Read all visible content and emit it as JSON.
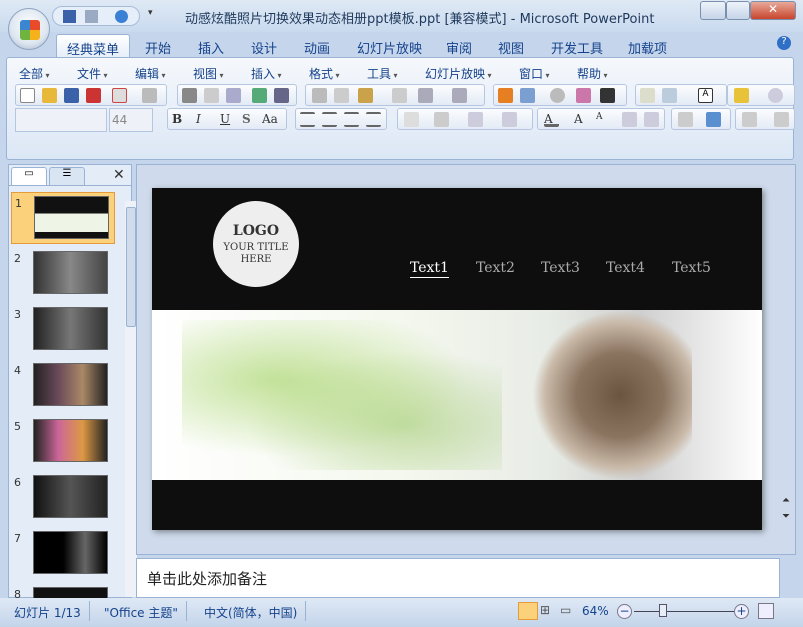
{
  "window": {
    "title": "动感炫酷照片切换效果动态相册ppt模板.ppt [兼容模式] - Microsoft PowerPoint"
  },
  "tabs": [
    {
      "label": "经典菜单",
      "active": true
    },
    {
      "label": "开始"
    },
    {
      "label": "插入"
    },
    {
      "label": "设计"
    },
    {
      "label": "动画"
    },
    {
      "label": "幻灯片放映"
    },
    {
      "label": "审阅"
    },
    {
      "label": "视图"
    },
    {
      "label": "开发工具"
    },
    {
      "label": "加载项"
    }
  ],
  "menus": [
    "全部",
    "文件",
    "编辑",
    "视图",
    "插入",
    "格式",
    "工具",
    "幻灯片放映",
    "窗口",
    "帮助"
  ],
  "font_size": "44",
  "format_buttons": [
    "B",
    "I",
    "U",
    "S",
    "Aa"
  ],
  "slide": {
    "logo": "LOGO",
    "logo_sub": "YOUR TITLE HERE",
    "nav": [
      "Text1",
      "Text2",
      "Text3",
      "Text4",
      "Text5"
    ]
  },
  "thumbnails": [
    "1",
    "2",
    "3",
    "4",
    "5",
    "6",
    "7",
    "8"
  ],
  "notes_placeholder": "单击此处添加备注",
  "status": {
    "slide": "幻灯片 1/13",
    "theme": "\"Office 主题\"",
    "language": "中文(简体，中国)",
    "zoom": "64%"
  },
  "colors": {
    "accent": "#15428b",
    "selection": "#fbd27b"
  }
}
